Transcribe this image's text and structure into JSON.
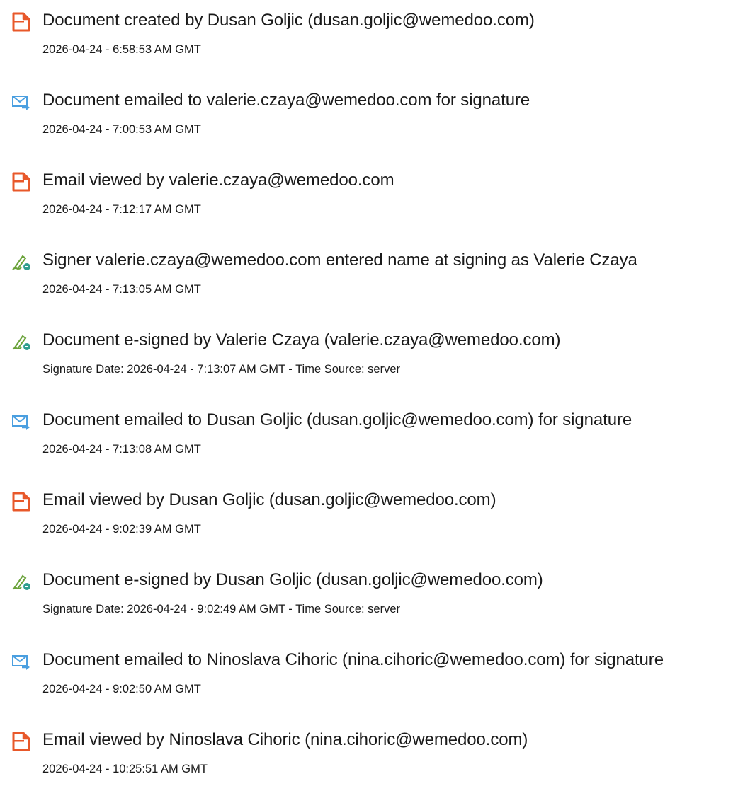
{
  "colors": {
    "doc_icon": "#e8582a",
    "email_icon": "#4a9fe0",
    "sign_icon": "#6aa33a",
    "sign_badge": "#2f9e8f"
  },
  "events": [
    {
      "icon": "document-icon",
      "title": "Document created by Dusan Goljic (dusan.goljic@wemedoo.com)",
      "date": "2026-04-24 - 6:58:53 AM GMT"
    },
    {
      "icon": "email-send-icon",
      "title": "Document emailed to valerie.czaya@wemedoo.com for signature",
      "date": "2026-04-24 - 7:00:53 AM GMT"
    },
    {
      "icon": "document-icon",
      "title": "Email viewed by valerie.czaya@wemedoo.com",
      "date": "2026-04-24 - 7:12:17 AM GMT"
    },
    {
      "icon": "signature-pen-icon",
      "title": "Signer valerie.czaya@wemedoo.com entered name at signing as Valerie Czaya",
      "date": "2026-04-24 - 7:13:05 AM GMT"
    },
    {
      "icon": "signature-pen-icon",
      "title": "Document e-signed by Valerie Czaya (valerie.czaya@wemedoo.com)",
      "date": "Signature Date: 2026-04-24 - 7:13:07 AM GMT - Time Source: server"
    },
    {
      "icon": "email-send-icon",
      "title": "Document emailed to Dusan Goljic (dusan.goljic@wemedoo.com) for signature",
      "date": "2026-04-24 - 7:13:08 AM GMT"
    },
    {
      "icon": "document-icon",
      "title": "Email viewed by Dusan Goljic (dusan.goljic@wemedoo.com)",
      "date": "2026-04-24 - 9:02:39 AM GMT"
    },
    {
      "icon": "signature-pen-icon",
      "title": "Document e-signed by Dusan Goljic (dusan.goljic@wemedoo.com)",
      "date": "Signature Date: 2026-04-24 - 9:02:49 AM GMT - Time Source: server"
    },
    {
      "icon": "email-send-icon",
      "title": "Document emailed to Ninoslava Cihoric (nina.cihoric@wemedoo.com) for signature",
      "date": "2026-04-24 - 9:02:50 AM GMT"
    },
    {
      "icon": "document-icon",
      "title": "Email viewed by Ninoslava Cihoric (nina.cihoric@wemedoo.com)",
      "date": "2026-04-24 - 10:25:51 AM GMT"
    }
  ]
}
